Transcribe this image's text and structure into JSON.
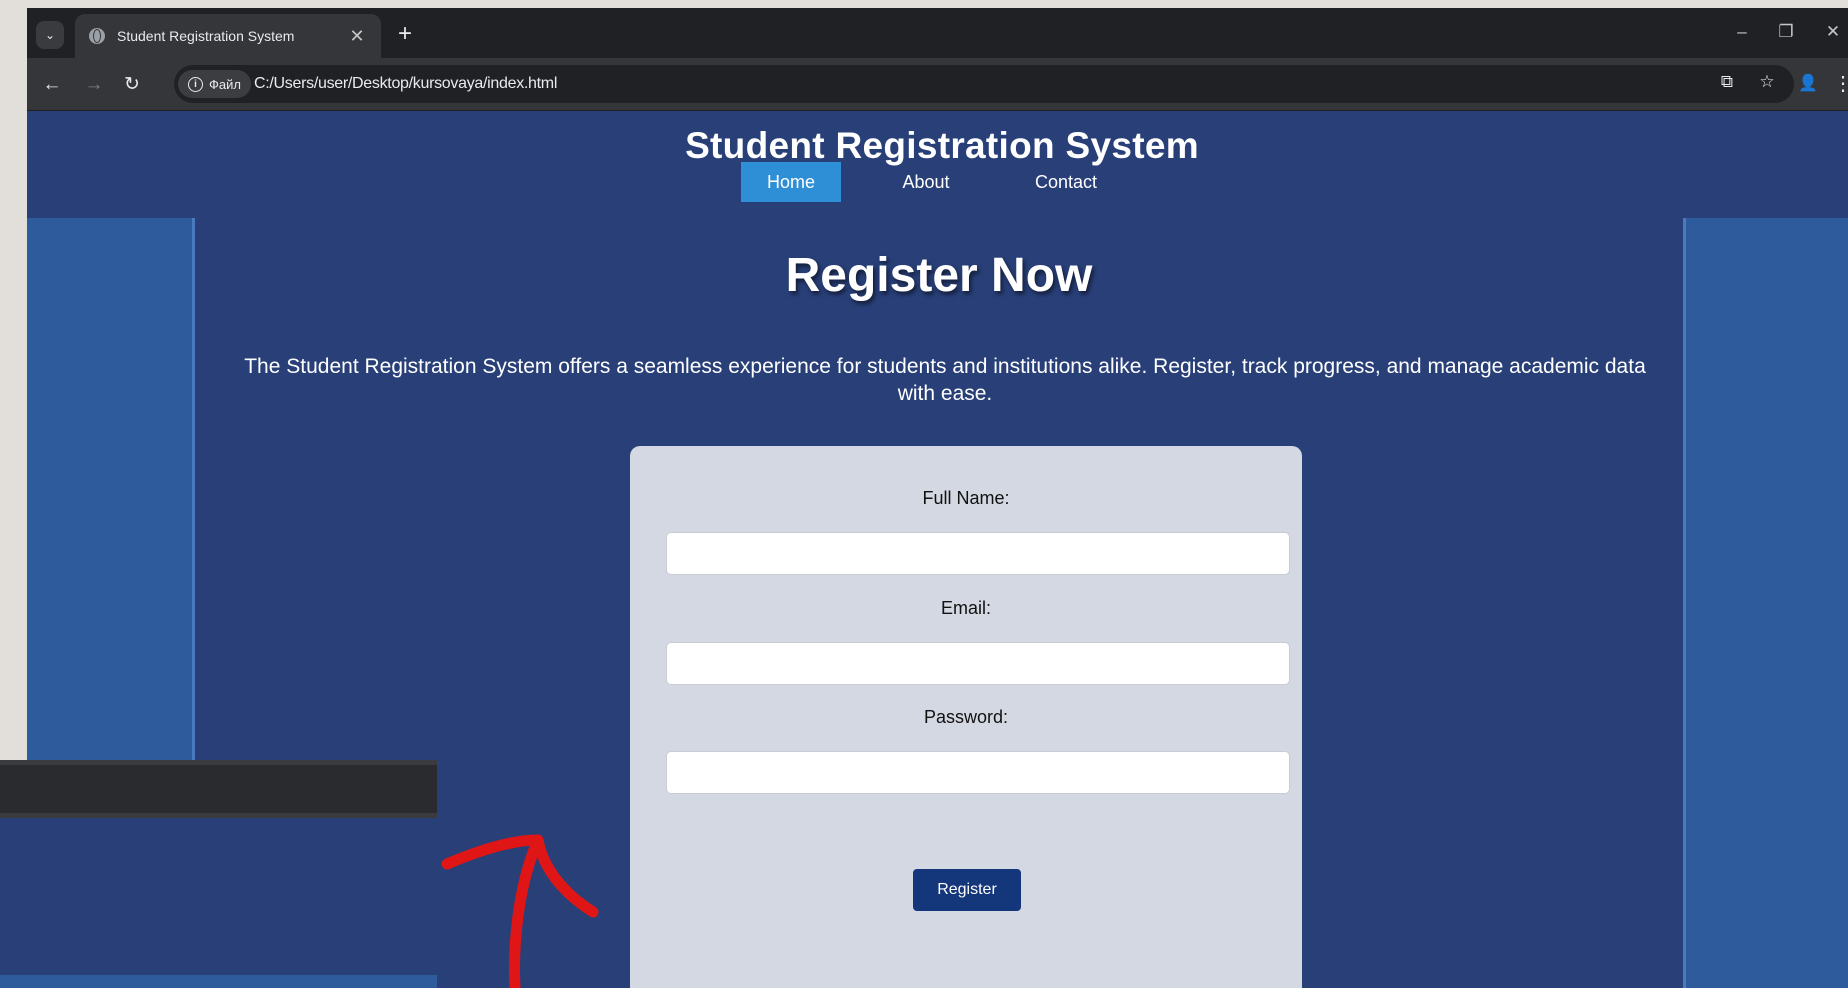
{
  "browser": {
    "tab_title": "Student Registration System",
    "tab_close": "✕",
    "new_tab": "+",
    "site_chip": "Файл",
    "url": "C:/Users/user/Desktop/kursovaya/index.html",
    "window_controls": {
      "minimize": "–",
      "restore": "❐",
      "close": "✕"
    }
  },
  "site": {
    "title": "Student Registration System",
    "nav": [
      {
        "label": "Home",
        "active": true
      },
      {
        "label": "About",
        "active": false
      },
      {
        "label": "Contact",
        "active": false
      }
    ]
  },
  "main": {
    "heading": "Register Now",
    "intro": "The Student Registration System offers a seamless experience for students and institutions alike. Register, track progress, and manage academic data with ease.",
    "form": {
      "full_name_label": "Full Name:",
      "full_name_value": "",
      "email_label": "Email:",
      "email_value": "",
      "password_label": "Password:",
      "password_value": "",
      "submit_label": "Register"
    }
  },
  "annotation": {
    "arrow_color": "#e01616"
  },
  "colors": {
    "page_bg": "#283f78",
    "side_panel": "#2e5b9c",
    "nav_active": "#2f8fd6",
    "form_bg": "#d4d8e2",
    "button": "#14367a"
  }
}
